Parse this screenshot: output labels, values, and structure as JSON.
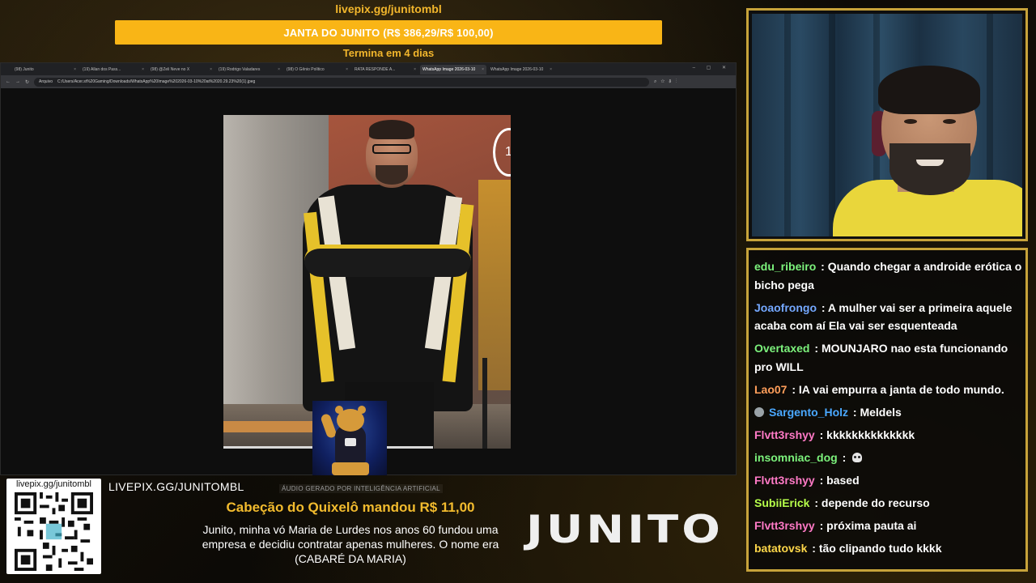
{
  "goal": {
    "url": "livepix.gg/junitombl",
    "title": "JANTA DO JUNITO (R$ 386,29/R$ 100,00)",
    "ends": "Termina em 4 dias",
    "progress_pct": 100,
    "color": "#f7b21b"
  },
  "browser": {
    "tabs": [
      {
        "label": "(98) Junito",
        "active": false
      },
      {
        "label": "(19) Allan dos Pass...",
        "active": false
      },
      {
        "label": "(98) @Zeli Neve no X",
        "active": false
      },
      {
        "label": "(19) Rodrigo Valadares",
        "active": false
      },
      {
        "label": "(98) O Gênio Político",
        "active": false
      },
      {
        "label": "RATA RESPONDE A...",
        "active": false
      },
      {
        "label": "WhatsApp Image 2026-03-10",
        "active": true
      },
      {
        "label": "WhatsApp Image 2026-03-10",
        "active": false
      }
    ],
    "url_prefix": "Arquivo",
    "url": "C:/Users/Acer.st%20Gaming/Downloads/WhatsApp%20Image%202026-03-10%20at%2020.29.23%20(1).jpeg",
    "photo_badge": "1",
    "video_progress": 0.73
  },
  "chat": [
    {
      "user": "edu_ribeiro",
      "color": "#7cf27c",
      "text": "Quando chegar a androide erótica o bicho pega"
    },
    {
      "user": "Joaofrongo",
      "color": "#74a8ff",
      "text": "A mulher vai ser a primeira aquele acaba com aí Ela vai ser esquenteada"
    },
    {
      "user": "Overtaxed",
      "color": "#7cf27c",
      "text": "MOUNJARO nao esta funcionando pro WILL"
    },
    {
      "user": "Lao07",
      "color": "#ff9e5a",
      "text": "IA vai empurra a janta de todo mundo."
    },
    {
      "user": "Sargento_Holz",
      "color": "#4aa8ff",
      "text": "Meldels",
      "badge": true
    },
    {
      "user": "Flvtt3rshyy",
      "color": "#ff7ac6",
      "text": "kkkkkkkkkkkkkk"
    },
    {
      "user": "insomniac_dog",
      "color": "#7cf27c",
      "text": "",
      "skull": true
    },
    {
      "user": "Flvtt3rshyy",
      "color": "#ff7ac6",
      "text": "based"
    },
    {
      "user": "SubiiErick",
      "color": "#b6ff4a",
      "text": "depende do recurso"
    },
    {
      "user": "Flvtt3rshyy",
      "color": "#ff7ac6",
      "text": "próxima pauta ai"
    },
    {
      "user": "batatovsk",
      "color": "#ffd84a",
      "text": "tão clipando tudo kkkk"
    }
  ],
  "donation": {
    "qr_label": "livepix.gg/junitombl",
    "site": "LIVEPIX.GG/JUNITOMBL",
    "ai_tag": "ÁUDIO GERADO POR INTELIGÊNCIA ARTIFICIAL",
    "title": "Cabeção do Quixelô mandou R$ 11,00",
    "message": "Junito, minha vó Maria de Lurdes nos anos 60 fundou uma empresa e decidiu contratar apenas mulheres. O nome era (CABARÉ DA MARIA)"
  },
  "logo": "JUNITO",
  "colors": {
    "accent": "#f2bb2e",
    "frame": "#c7a33a"
  }
}
